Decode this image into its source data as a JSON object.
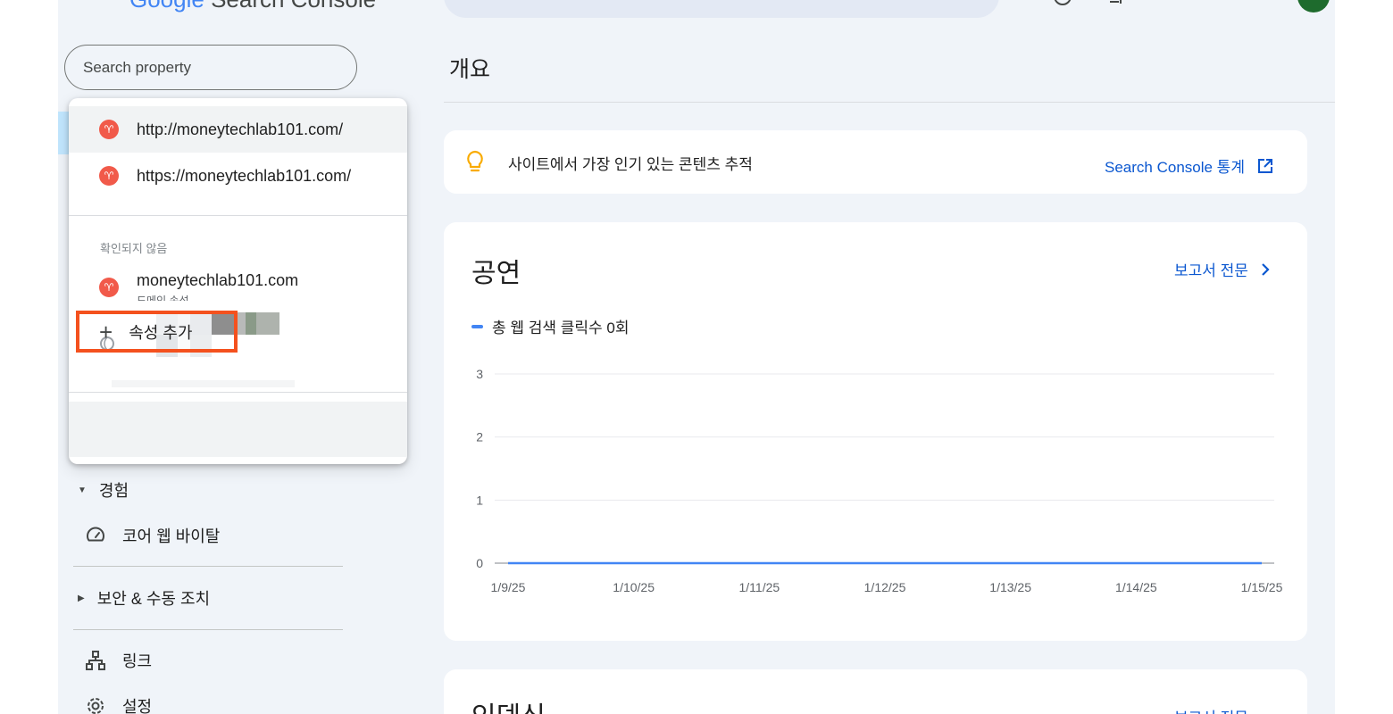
{
  "app": {
    "logo_text_google": "Google",
    "logo_text_product": "Search Console"
  },
  "sidebar": {
    "search_placeholder": "Search property",
    "property_dropdown": {
      "verified_properties": [
        {
          "url": "http://moneytechlab101.com/",
          "selected": true
        },
        {
          "url": "https://moneytechlab101.com/",
          "selected": false
        }
      ],
      "unverified_section_label": "확인되지 않음",
      "unverified_properties": [
        {
          "url": "moneytechlab101.com",
          "sublabel": "도메인 속성"
        }
      ],
      "add_property_label": "속성 추가"
    },
    "nav": {
      "experience_section": "경험",
      "core_web_vitals": "코어 웹 바이탈",
      "security_section": "보안 & 수동 조치",
      "links": "링크",
      "settings": "설정"
    }
  },
  "main": {
    "page_title": "개요",
    "tip": {
      "text": "사이트에서 가장 인기 있는 콘텐츠 추적",
      "link": "Search Console 통계"
    },
    "performance": {
      "title": "공연",
      "report_link": "보고서 전문",
      "legend": "총 웹 검색 클릭수 0회"
    },
    "indexing": {
      "title": "인덱싱",
      "report_link": "보고서 전문"
    }
  },
  "chart_data": {
    "type": "line",
    "title": "공연",
    "x": [
      "1/9/25",
      "1/10/25",
      "1/11/25",
      "1/12/25",
      "1/13/25",
      "1/14/25",
      "1/15/25"
    ],
    "series": [
      {
        "name": "총 웹 검색 클릭수 0회",
        "values": [
          0,
          0,
          0,
          0,
          0,
          0,
          0
        ]
      }
    ],
    "y_ticks": [
      0,
      1,
      2,
      3
    ],
    "ylim": [
      0,
      3
    ],
    "grid": true,
    "legend_placement": "top-left",
    "colors": {
      "series": "#4285f4"
    }
  },
  "colors": {
    "accent_link": "#0b57d0",
    "highlight_box": "#f4511e",
    "favicon": "#f15a4a"
  }
}
